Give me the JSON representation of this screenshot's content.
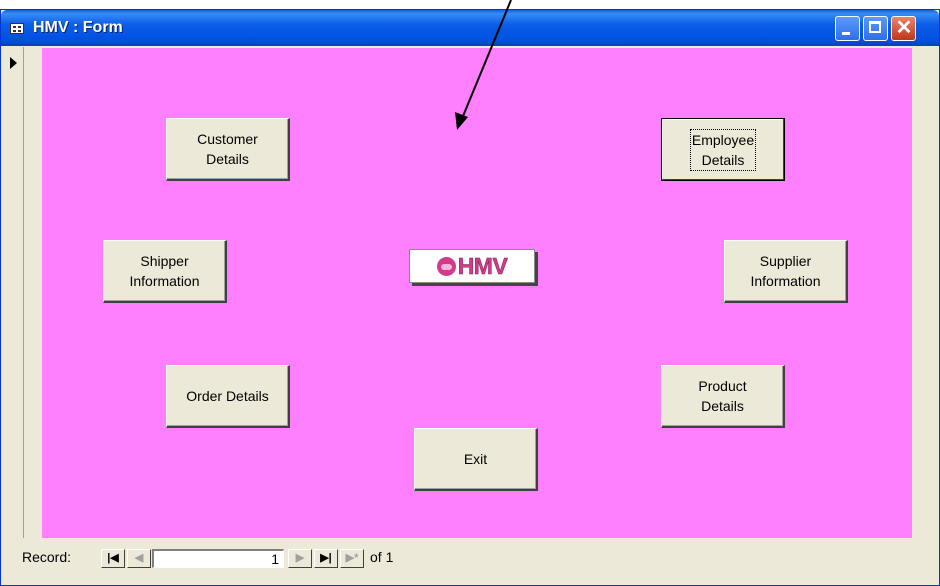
{
  "window": {
    "title": "HMV : Form"
  },
  "colors": {
    "form_background": "#ff80ff",
    "title_bar": "#0054e3",
    "logo": "#d23a8c"
  },
  "logo": {
    "text": "HMV",
    "icon": "hmv-dog-logo-icon"
  },
  "buttons": {
    "customer_details": "Customer\nDetails",
    "employee_details": "Employee\nDetails",
    "shipper_information": "Shipper\nInformation",
    "supplier_information": "Supplier\nInformation",
    "order_details": "Order Details",
    "product_details": "Product\nDetails",
    "exit": "Exit"
  },
  "navigation": {
    "label": "Record:",
    "current_record": "1",
    "of_text": "of  1",
    "first_icon": "first-record-icon",
    "prev_icon": "previous-record-icon",
    "next_icon": "next-record-icon",
    "last_icon": "last-record-icon",
    "new_icon": "new-record-icon"
  }
}
